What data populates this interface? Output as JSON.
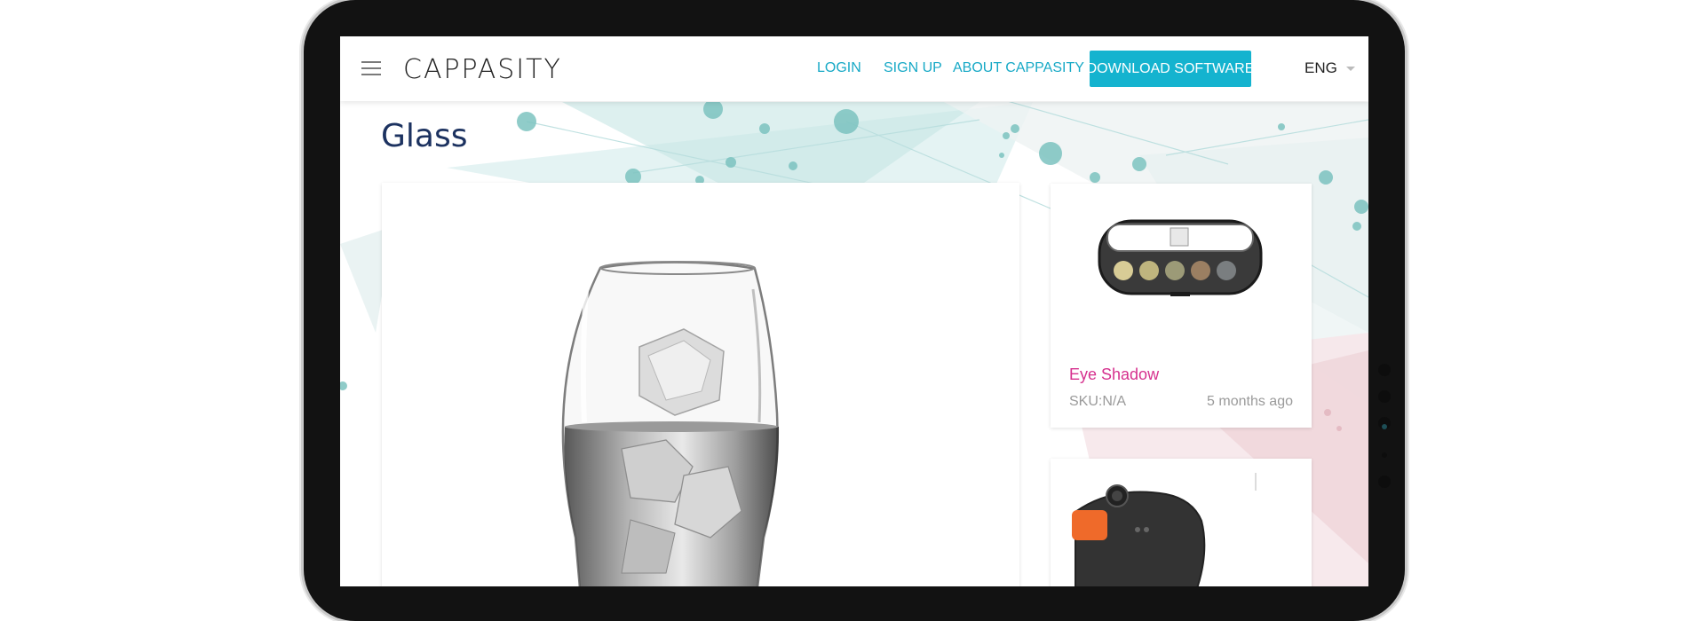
{
  "header": {
    "logo_text": "CAPPASITY",
    "nav": {
      "login": "LOGIN",
      "signup": "SIGN UP",
      "about": "ABOUT CAPPASITY"
    },
    "download_button": "DOWNLOAD SOFTWARE",
    "language": "ENG"
  },
  "page": {
    "title": "Glass"
  },
  "sidebar_cards": [
    {
      "title": "Eye Shadow",
      "sku": "SKU:N/A",
      "time": "5 months ago"
    }
  ],
  "colors": {
    "accent": "#14b3cf",
    "title": "#1c3260",
    "card_title": "#d6318e",
    "bezel": "#121212"
  },
  "icons": {
    "menu": "hamburger-icon",
    "language_dropdown": "caret-down-icon",
    "favorite": "heart-icon",
    "fullscreen": "fullscreen-icon"
  }
}
